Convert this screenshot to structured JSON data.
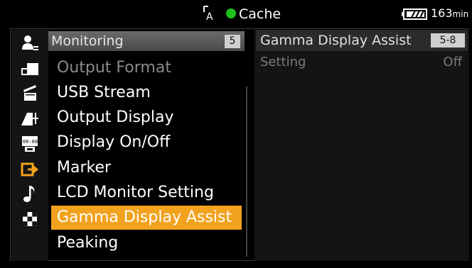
{
  "status": {
    "record_mode_icon": "clip-record-icon",
    "record_label": "Cache",
    "battery_icon": "battery-icon",
    "battery_minutes": "163",
    "battery_unit": "min"
  },
  "categories": [
    {
      "icon": "user-menu-icon"
    },
    {
      "icon": "camera-icon"
    },
    {
      "icon": "clapper-icon"
    },
    {
      "icon": "audio-level-icon"
    },
    {
      "icon": "timecode-icon"
    },
    {
      "icon": "output-icon"
    },
    {
      "icon": "music-note-icon"
    },
    {
      "icon": "checker-icon"
    }
  ],
  "menu": {
    "title": "Monitoring",
    "badge": "5",
    "items": [
      {
        "label": "Output Format"
      },
      {
        "label": "USB Stream"
      },
      {
        "label": "Output Display"
      },
      {
        "label": "Display On/Off"
      },
      {
        "label": "Marker"
      },
      {
        "label": "LCD Monitor Setting"
      },
      {
        "label": "Gamma Display Assist"
      },
      {
        "label": "Peaking"
      }
    ],
    "selected_index": 6
  },
  "detail": {
    "title": "Gamma Display Assist",
    "badge": "5-8",
    "setting_label": "Setting",
    "setting_value": "Off"
  }
}
